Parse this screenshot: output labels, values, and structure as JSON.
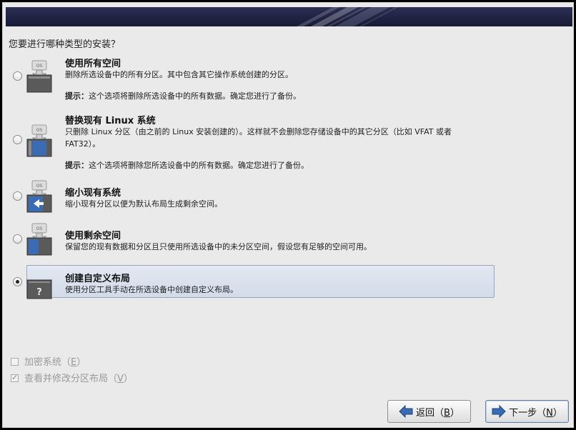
{
  "question": "您要进行哪种类型的安装？",
  "options": [
    {
      "title": "使用所有空间",
      "description": "删除所选设备中的所有分区。其中包含其它操作系统创建的分区。",
      "tip_label": "提示：",
      "tip_text": "这个选项将删除所选设备中的所有数据。确定您进行了备份。",
      "icon": "drive-wipe-icon",
      "selected": false
    },
    {
      "title": "替换现有 Linux 系统",
      "description": "只删除 Linux 分区（由之前的 Linux 安装创建的）。这样就不会删除您存储设备中的其它分区（比如 VFAT 或者 FAT32）。",
      "tip_label": "提示：",
      "tip_text": "这个选项将删除您所选设备中的所有数据。确定您进行了备份。",
      "icon": "drive-replace-icon",
      "selected": false
    },
    {
      "title": "缩小现有系统",
      "description": "缩小现有分区以便为默认布局生成剩余空间。",
      "icon": "drive-shrink-icon",
      "selected": false
    },
    {
      "title": "使用剩余空间",
      "description": "保留您的现有数据和分区且只使用所选设备中的未分区空间，假设您有足够的空间可用。",
      "icon": "drive-free-space-icon",
      "selected": false
    },
    {
      "title": "创建自定义布局",
      "description": "使用分区工具手动在所选设备中创建自定义布局。",
      "icon": "drive-custom-icon",
      "selected": true
    }
  ],
  "checkboxes": [
    {
      "label": "加密系统",
      "mnemonic": "E",
      "checked": false
    },
    {
      "label": "查看并修改分区布局",
      "mnemonic": "V",
      "checked": true
    }
  ],
  "buttons": {
    "back_label": "返回",
    "back_mnemonic": "B",
    "next_label": "下一步",
    "next_mnemonic": "N"
  },
  "colors": {
    "banner": "#1e2140",
    "selected_row": "#d9e0ee",
    "arrow_blue": "#3a6bb5"
  }
}
